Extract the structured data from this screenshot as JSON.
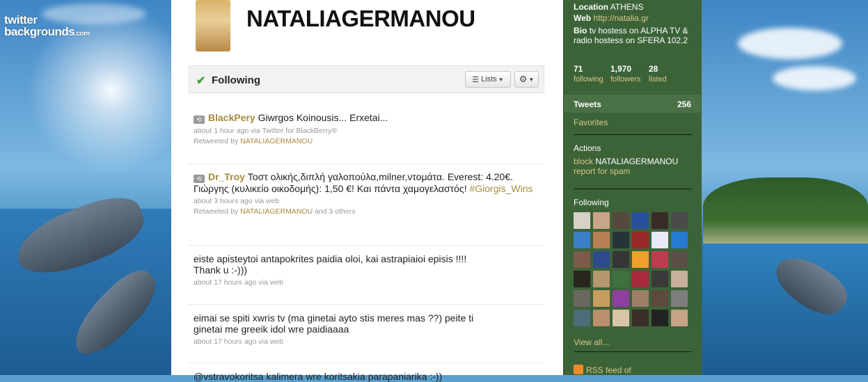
{
  "background": {
    "logo_line1": "twitter",
    "logo_line2": "backgrounds",
    "logo_suffix": ".com"
  },
  "profile": {
    "screen_name": "NATALIAGERMANOU"
  },
  "follow_bar": {
    "status": "Following",
    "lists_label": "Lists",
    "gear_icon": "gear-icon"
  },
  "tweets": [
    {
      "user": "BlackPery",
      "text": " Giwrgos Koinousis... Erxetai...",
      "meta": "about 1 hour ago via Twitter for BlackBerry®",
      "rt_prefix": "Retweeted by ",
      "rt_by": "NATALIAGERMANOU",
      "rt_suffix": ""
    },
    {
      "user": "Dr_Troy",
      "text": " Τοστ ολικής,διπλή γαλοπούλα,milner,ντομάτα. Everest: 4.20€. Γιώργης (κυλικείο οικοδομής): 1,50 €! Και πάντα χαμογελαστός! ",
      "hashtag": "#Giorgis_Wins",
      "meta": "about 3 hours ago via web",
      "rt_prefix": "Retweeted by ",
      "rt_by": "NATALIAGERMANOU",
      "rt_suffix": " and 3 others"
    },
    {
      "text": "eiste apisteytoi antapokrites paidia oloi, kai astrapiaioi episis !!!! Thank u :-)))",
      "meta": "about 17 hours ago via web"
    },
    {
      "text": "eimai se spiti xwris tv (ma ginetai ayto stis meres mas ??) peite ti ginetai me greeik idol wre paidiaaaa",
      "meta": "about 17 hours ago via web"
    },
    {
      "text": "@vstravokoritsa kalimera wre koritsakia parapaniarika :-))"
    }
  ],
  "sidebar": {
    "location_label": "Location",
    "location_value": "ATHENS",
    "web_label": "Web",
    "web_value": "http://natalia.gr",
    "bio_label": "Bio",
    "bio_value": "tv hostess on ALPHA TV & radio hostess on SFERA 102,2",
    "stats": [
      {
        "num": "71",
        "label": "following"
      },
      {
        "num": "1,970",
        "label": "followers"
      },
      {
        "num": "28",
        "label": "listed"
      }
    ],
    "tweets_label": "Tweets",
    "tweets_count": "256",
    "favorites": "Favorites",
    "actions_title": "Actions",
    "block_label": "block",
    "block_user": "NATALIAGERMANOU",
    "report_label": "report for spam",
    "following_title": "Following",
    "view_all": "View all...",
    "rss_label": "RSS feed of"
  },
  "colors": {
    "sidebar_bg": "#3c6338",
    "link": "#a48b3f",
    "sidebar_link": "#d8c58a"
  }
}
